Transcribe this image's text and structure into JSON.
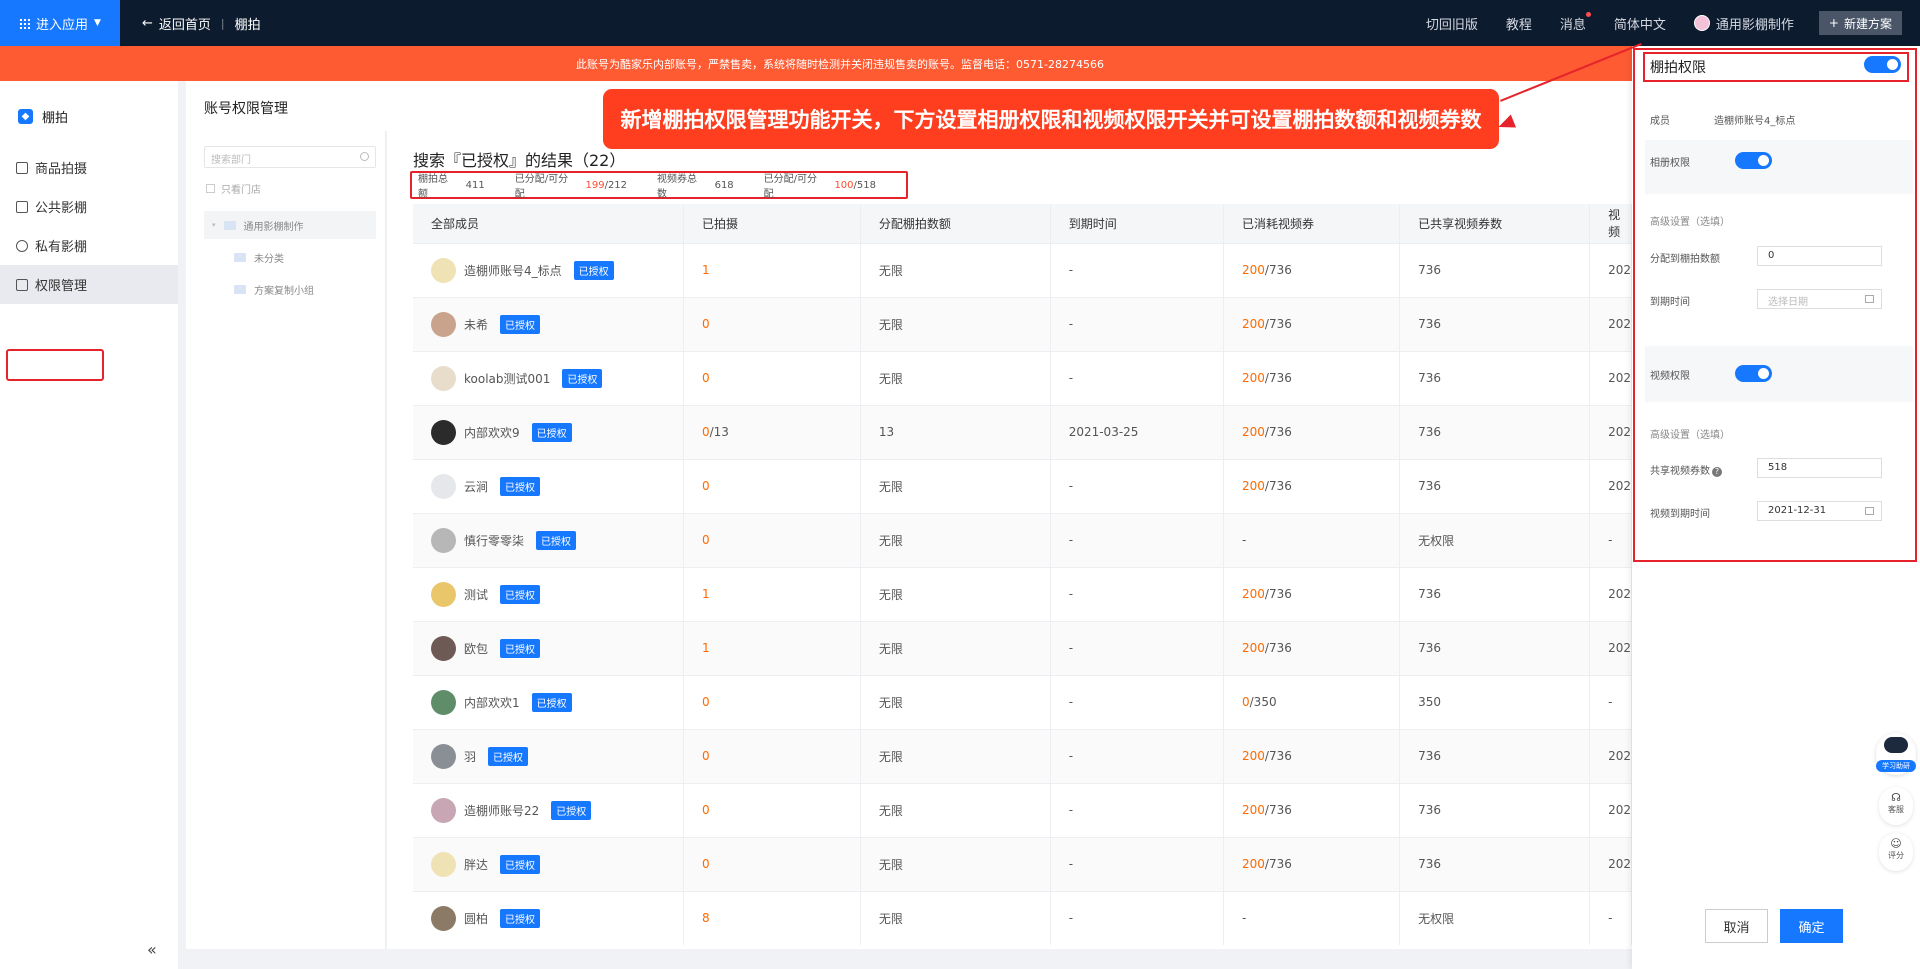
{
  "topbar": {
    "enter_app": "进入应用",
    "back_home": "返回首页",
    "crumb": "棚拍",
    "links": [
      "切回旧版",
      "教程",
      "消息",
      "简体中文"
    ],
    "user": "通用影棚制作",
    "new_plan": "新建方案"
  },
  "warning": "此账号为酷家乐内部账号，严禁售卖，系统将随时检测并关闭违规售卖的账号。监督电话：0571-28274566",
  "sidebar": {
    "brand": "棚拍",
    "items": [
      "商品拍摄",
      "公共影棚",
      "私有影棚",
      "权限管理"
    ],
    "collapse": "«"
  },
  "page_title": "账号权限管理",
  "tree": {
    "search_placeholder": "搜索部门",
    "only_store": "只看门店",
    "root": "通用影棚制作",
    "children": [
      "未分类",
      "方案复制小组"
    ]
  },
  "result_title": "搜索『已授权』的结果（22）",
  "stats": {
    "label1": "棚拍总额",
    "value1": "411",
    "label2": "已分配/可分配",
    "value2a": "199",
    "value2b": "/212",
    "label3": "视频券总数",
    "value3": "618",
    "label4": "已分配/可分配",
    "value4a": "100",
    "value4b": "/518"
  },
  "callout": "新增棚拍权限管理功能开关，下方设置相册权限和视频权限开关并可设置棚拍数额和视频券数",
  "table": {
    "headers": [
      "全部成员",
      "已拍摄",
      "分配棚拍数额",
      "到期时间",
      "已消耗视频券",
      "已共享视频券数",
      "视频"
    ],
    "badge": "已授权",
    "rows": [
      {
        "name": "造棚师账号4_标点",
        "shot": "1",
        "shot_total": "",
        "quota": "无限",
        "expire": "-",
        "used": "200",
        "used_total": "/736",
        "shared": "736",
        "video": "202"
      },
      {
        "name": "未希",
        "shot": "0",
        "shot_total": "",
        "quota": "无限",
        "expire": "-",
        "used": "200",
        "used_total": "/736",
        "shared": "736",
        "video": "202"
      },
      {
        "name": "koolab测试001",
        "shot": "0",
        "shot_total": "",
        "quota": "无限",
        "expire": "-",
        "used": "200",
        "used_total": "/736",
        "shared": "736",
        "video": "202"
      },
      {
        "name": "内部欢欢9",
        "shot": "0",
        "shot_total": "/13",
        "quota": "13",
        "expire": "2021-03-25",
        "used": "200",
        "used_total": "/736",
        "shared": "736",
        "video": "202"
      },
      {
        "name": "云涧",
        "shot": "0",
        "shot_total": "",
        "quota": "无限",
        "expire": "-",
        "used": "200",
        "used_total": "/736",
        "shared": "736",
        "video": "202"
      },
      {
        "name": "慎行零零柒",
        "shot": "0",
        "shot_total": "",
        "quota": "无限",
        "expire": "-",
        "used": "",
        "used_total": "-",
        "shared": "无权限",
        "video": "-"
      },
      {
        "name": "测试",
        "shot": "1",
        "shot_total": "",
        "quota": "无限",
        "expire": "-",
        "used": "200",
        "used_total": "/736",
        "shared": "736",
        "video": "202"
      },
      {
        "name": "欧包",
        "shot": "1",
        "shot_total": "",
        "quota": "无限",
        "expire": "-",
        "used": "200",
        "used_total": "/736",
        "shared": "736",
        "video": "202"
      },
      {
        "name": "内部欢欢1",
        "shot": "0",
        "shot_total": "",
        "quota": "无限",
        "expire": "-",
        "used": "0",
        "used_total": "/350",
        "shared": "350",
        "video": "-"
      },
      {
        "name": "羽",
        "shot": "0",
        "shot_total": "",
        "quota": "无限",
        "expire": "-",
        "used": "200",
        "used_total": "/736",
        "shared": "736",
        "video": "202"
      },
      {
        "name": "造棚师账号22",
        "shot": "0",
        "shot_total": "",
        "quota": "无限",
        "expire": "-",
        "used": "200",
        "used_total": "/736",
        "shared": "736",
        "video": "202"
      },
      {
        "name": "胖达",
        "shot": "0",
        "shot_total": "",
        "quota": "无限",
        "expire": "-",
        "used": "200",
        "used_total": "/736",
        "shared": "736",
        "video": "202"
      },
      {
        "name": "圆柏",
        "shot": "8",
        "shot_total": "",
        "quota": "无限",
        "expire": "-",
        "used": "",
        "used_total": "-",
        "shared": "无权限",
        "video": "-"
      }
    ]
  },
  "panel": {
    "title": "棚拍权限",
    "member_label": "成员",
    "member_value": "造棚师账号4_标点",
    "album_label": "相册权限",
    "adv1": "高级设置（选填）",
    "alloc_label": "分配到棚拍数额",
    "alloc_value": "0",
    "expire_label": "到期时间",
    "expire_placeholder": "选择日期",
    "video_label": "视频权限",
    "adv2": "高级设置（选填）",
    "share_label": "共享视频券数",
    "share_value": "518",
    "video_expire_label": "视频到期时间",
    "video_expire_value": "2021-12-31",
    "cancel": "取消",
    "confirm": "确定"
  },
  "floats": {
    "bot": "学习助研",
    "service": "客服",
    "review": "评分"
  }
}
